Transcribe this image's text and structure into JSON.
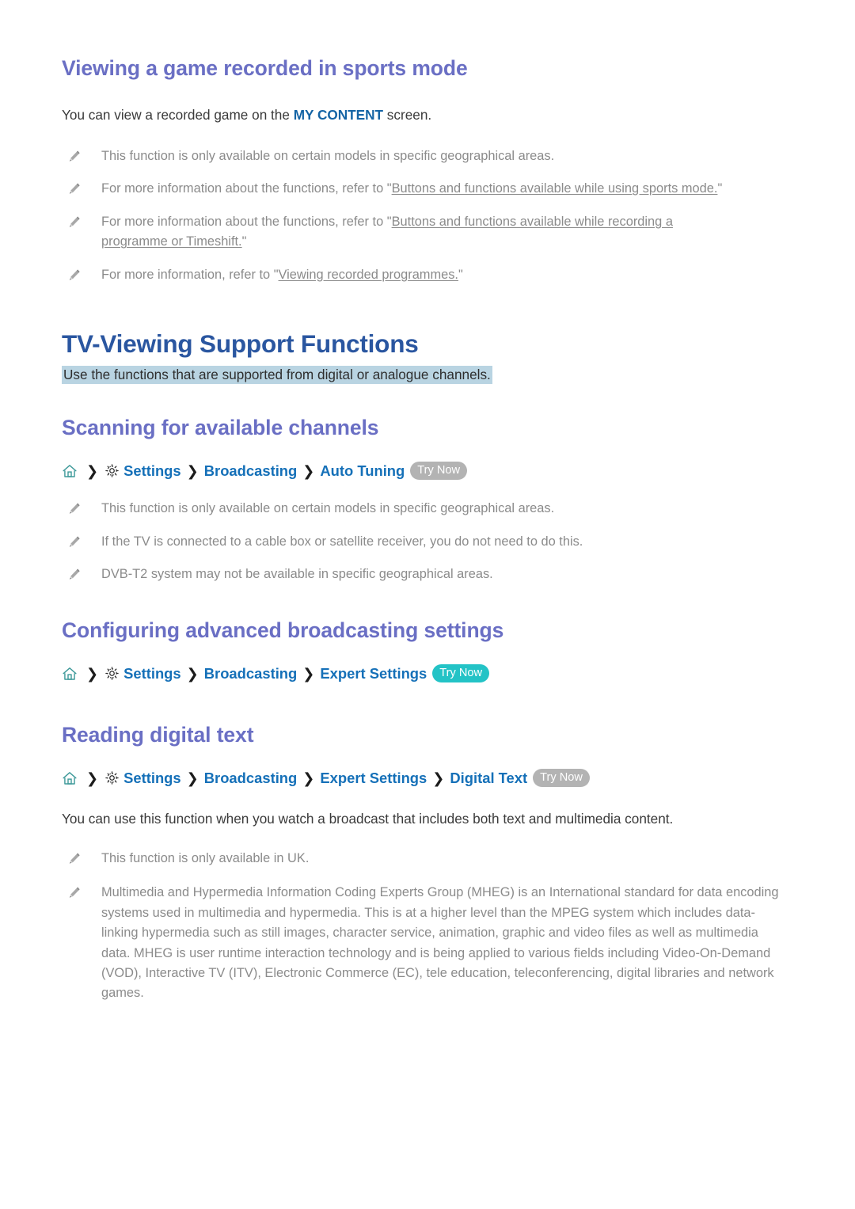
{
  "colors": {
    "main_heading": "#2a56a0",
    "sub_heading": "#6a6fc4",
    "link_blue": "#1570b8",
    "strong_link_blue": "#1464a5",
    "note_grey": "#8b8b8b",
    "highlight_bg": "#b9d4e2",
    "badge_grey": "#b3b3b3",
    "badge_teal": "#23c3c6",
    "home_icon": "#3f9a9a",
    "gear_icon": "#2b2b2b",
    "pencil_icon": "#9a9a9a"
  },
  "icons": {
    "home": "home-icon",
    "gear": "gear-icon",
    "pencil": "pencil-note-icon",
    "separator": "chevron-right-icon"
  },
  "sections": {
    "sports": {
      "heading": "Viewing a game recorded in sports mode",
      "intro_before": "You can view a recorded game on the ",
      "intro_link": "MY CONTENT",
      "intro_after": " screen.",
      "notes": [
        {
          "parts": [
            {
              "text": "This function is only available on certain models in specific geographical areas.",
              "underline": false
            }
          ]
        },
        {
          "parts": [
            {
              "text": "For more information about the functions, refer to \"",
              "underline": false
            },
            {
              "text": "Buttons and functions available while using sports mode.",
              "underline": true
            },
            {
              "text": "\"",
              "underline": false
            }
          ]
        },
        {
          "parts": [
            {
              "text": "For more information about the functions, refer to \"",
              "underline": false
            },
            {
              "text": "Buttons and functions available while recording a programme or Timeshift.",
              "underline": true
            },
            {
              "text": "\"",
              "underline": false
            }
          ]
        },
        {
          "parts": [
            {
              "text": "For more information, refer to \"",
              "underline": false
            },
            {
              "text": "Viewing recorded programmes.",
              "underline": true
            },
            {
              "text": "\"",
              "underline": false
            }
          ]
        }
      ]
    },
    "tv_viewing": {
      "heading": "TV-Viewing Support Functions",
      "subtitle_highlighted": "Use the functions that are supported from digital or analogue channels."
    },
    "scanning": {
      "heading": "Scanning for available channels",
      "path": {
        "items": [
          "Settings",
          "Broadcasting",
          "Auto Tuning"
        ],
        "separator": "❯",
        "badge_label": "Try Now",
        "badge_style": "grey"
      },
      "notes": [
        {
          "parts": [
            {
              "text": "This function is only available on certain models in specific geographical areas.",
              "underline": false
            }
          ]
        },
        {
          "parts": [
            {
              "text": "If the TV is connected to a cable box or satellite receiver, you do not need to do this.",
              "underline": false
            }
          ]
        },
        {
          "parts": [
            {
              "text": "DVB-T2 system may not be available in specific geographical areas.",
              "underline": false
            }
          ]
        }
      ]
    },
    "advanced": {
      "heading": "Configuring advanced broadcasting settings",
      "path": {
        "items": [
          "Settings",
          "Broadcasting",
          "Expert Settings"
        ],
        "separator": "❯",
        "badge_label": "Try Now",
        "badge_style": "teal"
      }
    },
    "digital_text": {
      "heading": "Reading digital text",
      "path": {
        "items": [
          "Settings",
          "Broadcasting",
          "Expert Settings",
          "Digital Text"
        ],
        "separator": "❯",
        "badge_label": "Try Now",
        "badge_style": "grey"
      },
      "intro": "You can use this function when you watch a broadcast that includes both text and multimedia content.",
      "notes": [
        {
          "parts": [
            {
              "text": "This function is only available in UK.",
              "underline": false
            }
          ]
        },
        {
          "parts": [
            {
              "text": "Multimedia and Hypermedia Information Coding Experts Group (MHEG) is an International standard for data encoding systems used in multimedia and hypermedia. This is at a higher level than the MPEG system which includes data-linking hypermedia such as still images, character service, animation, graphic and video files as well as multimedia data. MHEG is user runtime interaction technology and is being applied to various fields including Video-On-Demand (VOD), Interactive TV (ITV), Electronic Commerce (EC), tele education, teleconferencing, digital libraries and network games.",
              "underline": false
            }
          ]
        }
      ]
    }
  }
}
